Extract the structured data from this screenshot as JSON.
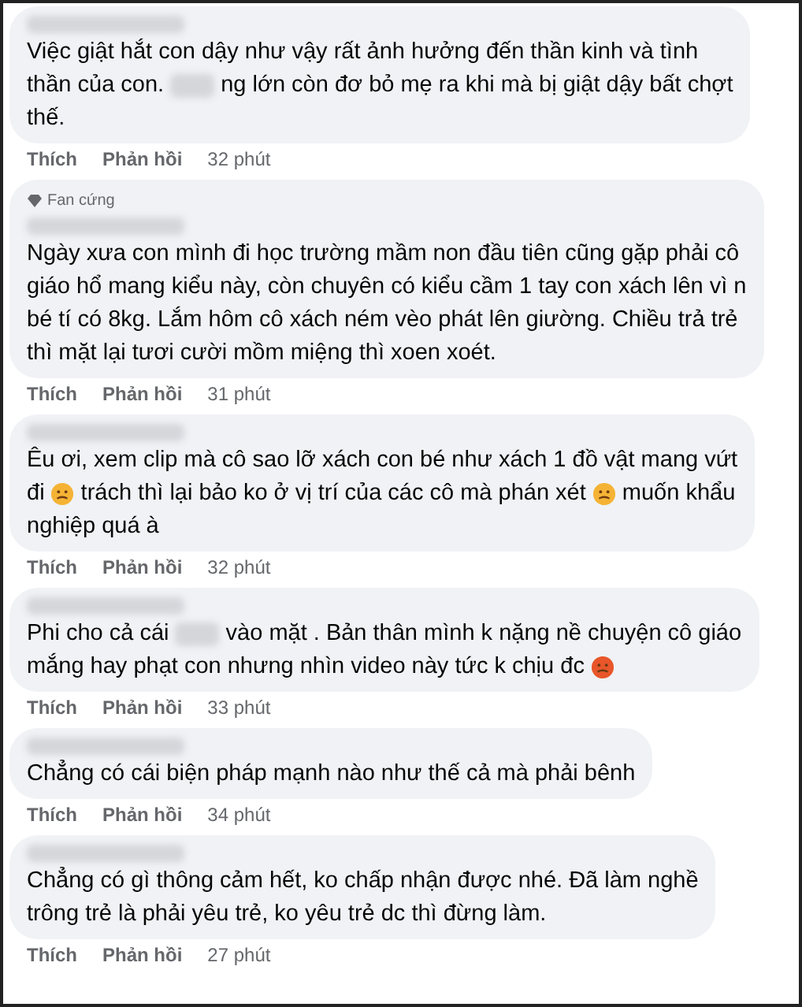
{
  "comments": [
    {
      "lines": [
        [
          {
            "kind": "text",
            "text": "Việc giật hắt con dậy như vậy rất ảnh hưởng đến thần kinh và tình"
          }
        ],
        [
          {
            "kind": "text",
            "text": "thần của con."
          },
          {
            "kind": "blur"
          },
          {
            "kind": "text",
            "text": "ng lớn còn đơ bỏ mẹ ra khi mà bị giật dậy bất chợt"
          }
        ],
        [
          {
            "kind": "text",
            "text": "thế."
          }
        ]
      ],
      "like": "Thích",
      "reply": "Phản hồi",
      "time": "32 phút"
    },
    {
      "badge": "Fan cứng",
      "lines": [
        [
          {
            "kind": "text",
            "text": "Ngày xưa con mình đi học trường mầm non đầu tiên cũng gặp phải cô"
          }
        ],
        [
          {
            "kind": "text",
            "text": "giáo hổ mang kiểu này, còn chuyên có kiểu cầm 1 tay con xách lên vì n"
          }
        ],
        [
          {
            "kind": "text",
            "text": "bé tí có 8kg. Lắm hôm cô xách ném vèo phát lên giường. Chiều trả trẻ"
          }
        ],
        [
          {
            "kind": "text",
            "text": "thì mặt lại tươi cười mồm miệng thì xoen xoét."
          }
        ]
      ],
      "like": "Thích",
      "reply": "Phản hồi",
      "time": "31 phút"
    },
    {
      "lines": [
        [
          {
            "kind": "text",
            "text": "Êu ơi, xem clip mà cô sao lỡ xách con bé như xách 1 đồ vật mang vứt"
          }
        ],
        [
          {
            "kind": "text",
            "text": "đi"
          },
          {
            "kind": "emoji",
            "color": "#f5b335"
          },
          {
            "kind": "text",
            "text": "trách thì lại bảo ko ở vị trí của các cô mà phán xét"
          },
          {
            "kind": "emoji",
            "color": "#f5b335"
          },
          {
            "kind": "text",
            "text": "muốn khẩu"
          }
        ],
        [
          {
            "kind": "text",
            "text": "nghiệp quá à"
          }
        ]
      ],
      "like": "Thích",
      "reply": "Phản hồi",
      "time": "32 phút"
    },
    {
      "lines": [
        [
          {
            "kind": "text",
            "text": "Phi cho cả cái"
          },
          {
            "kind": "blur"
          },
          {
            "kind": "text",
            "text": "vào mặt . Bản thân mình k nặng nề chuyện cô giáo"
          }
        ],
        [
          {
            "kind": "text",
            "text": "mắng hay phạt con nhưng nhìn video này tức k chịu đc"
          },
          {
            "kind": "emoji",
            "color": "#e8562a"
          }
        ]
      ],
      "like": "Thích",
      "reply": "Phản hồi",
      "time": "33 phút"
    },
    {
      "lines": [
        [
          {
            "kind": "text",
            "text": "Chẳng có cái biện pháp mạnh nào như thế cả mà phải bênh"
          }
        ]
      ],
      "like": "Thích",
      "reply": "Phản hồi",
      "time": "34 phút"
    },
    {
      "lines": [
        [
          {
            "kind": "text",
            "text": "Chẳng có gì thông cảm hết, ko chấp nhận được nhé. Đã làm nghề"
          }
        ],
        [
          {
            "kind": "text",
            "text": "trông trẻ là phải yêu trẻ, ko yêu trẻ dc thì đừng làm."
          }
        ]
      ],
      "like": "Thích",
      "reply": "Phản hồi",
      "time": "27 phút"
    }
  ]
}
